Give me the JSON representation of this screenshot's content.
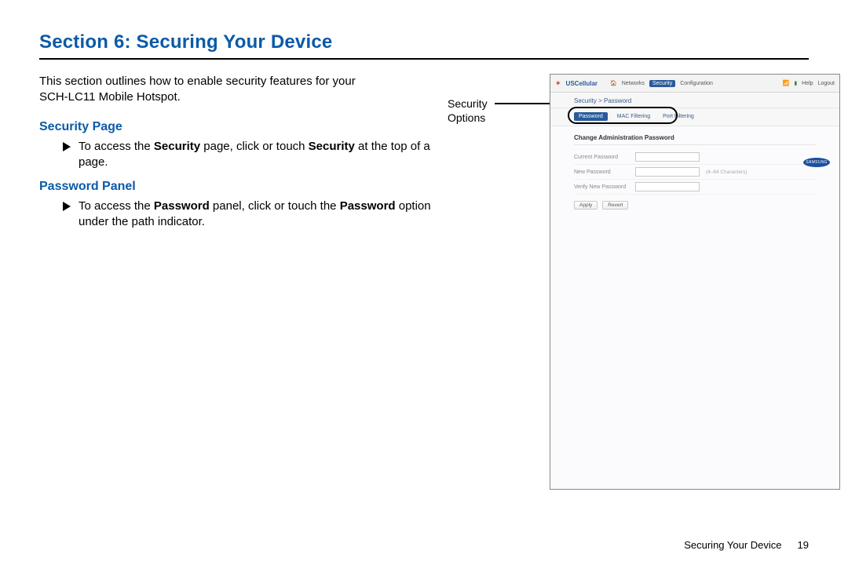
{
  "section": {
    "title": "Section 6: Securing Your Device",
    "intro_line1": "This section outlines how to enable security features for your",
    "intro_line2": "SCH-LC11 Mobile Hotspot."
  },
  "subsections": {
    "security_page": {
      "heading": "Security Page",
      "bullet_pre": "To access the ",
      "bullet_bold1": "Security",
      "bullet_mid": " page, click or touch ",
      "bullet_bold2": "Security",
      "bullet_post": " at the top of a page."
    },
    "password_panel": {
      "heading": "Password Panel",
      "bullet_pre": "To access the ",
      "bullet_bold1": "Password",
      "bullet_mid": " panel, click or touch the ",
      "bullet_bold2": "Password",
      "bullet_post": " option under the path indicator."
    }
  },
  "callout": {
    "label_line1": "Security",
    "label_line2": "Options"
  },
  "screenshot": {
    "brand": "USCellular",
    "header_items": {
      "home_icon": "🏠",
      "networks": "Networks",
      "security": "Security",
      "configuration": "Configuration",
      "help": "Help",
      "logout": "Logout"
    },
    "breadcrumb": "Security > Password",
    "tabs": {
      "active": "Password",
      "inactive1": "MAC Filtering",
      "inactive2": "Port Filtering"
    },
    "panel": {
      "title": "Change Administration Password",
      "fields": {
        "current": "Current Password",
        "new": "New Password",
        "new_hint": "(4–64 Characters)",
        "verify": "Verify New Password"
      },
      "buttons": {
        "apply": "Apply",
        "revert": "Revert"
      }
    },
    "logo_text": "SAMSUNG"
  },
  "footer": {
    "running_head": "Securing Your Device",
    "page_number": "19"
  }
}
